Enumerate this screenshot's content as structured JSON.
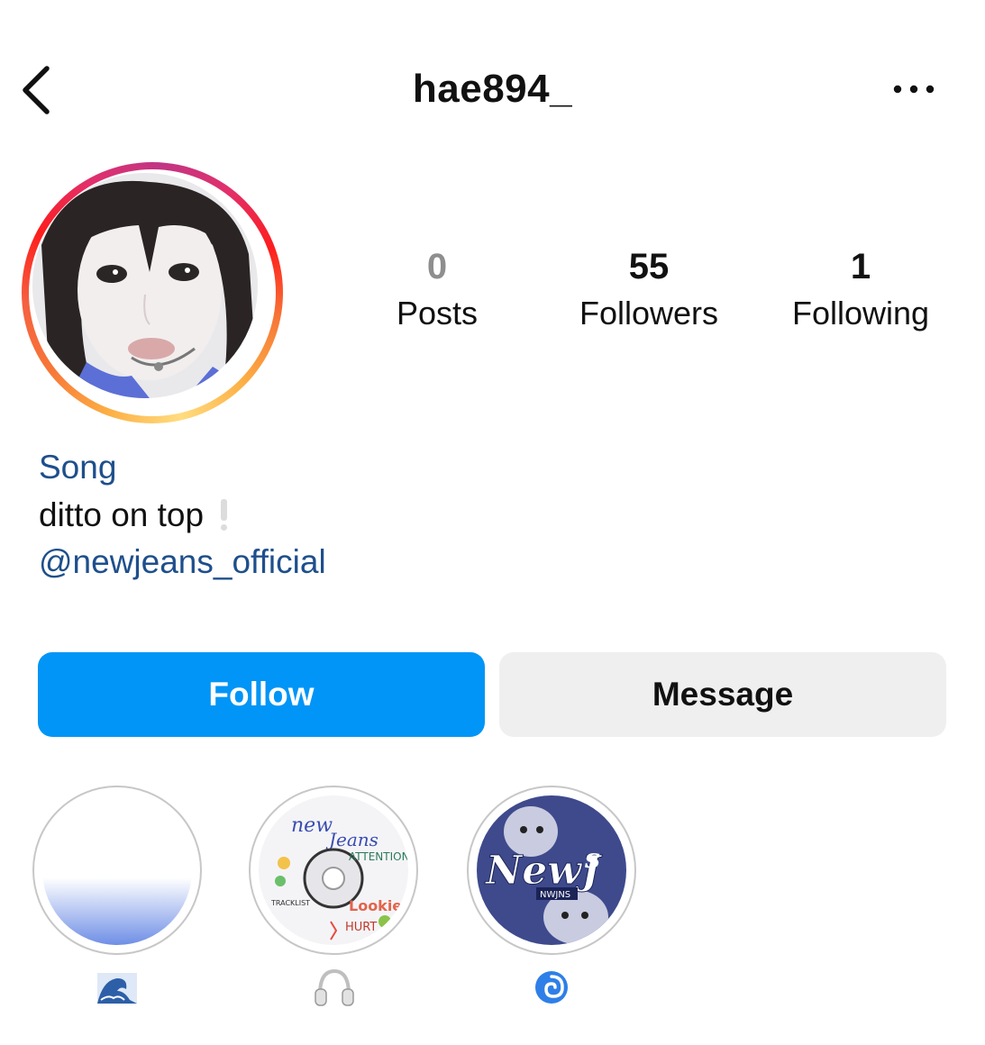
{
  "header": {
    "username": "hae894_",
    "back_icon": "chevron-left-icon",
    "more_icon": "more-horizontal-icon"
  },
  "stats": [
    {
      "value": "0",
      "label": "Posts"
    },
    {
      "value": "55",
      "label": "Followers"
    },
    {
      "value": "1",
      "label": "Following"
    }
  ],
  "bio": {
    "name": "Song",
    "text": "ditto on top",
    "text_icon": "white-exclamation-icon",
    "link": "@newjeans_official"
  },
  "actions": {
    "follow_label": "Follow",
    "message_label": "Message"
  },
  "highlights": [
    {
      "label_icon": "wave-emoji-icon"
    },
    {
      "label_icon": "headphones-emoji-icon"
    },
    {
      "label_icon": "cyclone-emoji-icon"
    }
  ],
  "colors": {
    "follow_blue": "#0095f6",
    "link_blue": "#1e4f8c",
    "message_gray": "#efefef"
  }
}
